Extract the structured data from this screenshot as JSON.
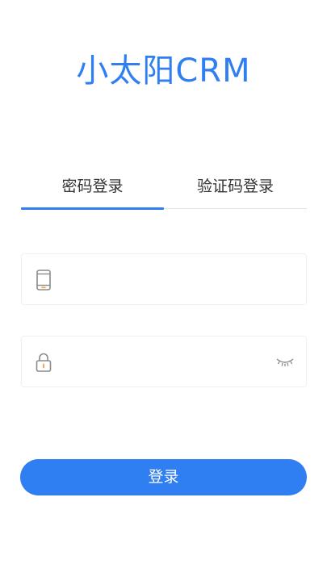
{
  "app": {
    "title": "小太阳CRM"
  },
  "tabs": [
    {
      "label": "密码登录",
      "active": true
    },
    {
      "label": "验证码登录",
      "active": false
    }
  ],
  "form": {
    "phone": {
      "value": "",
      "placeholder": "",
      "icon": "phone-icon"
    },
    "password": {
      "value": "",
      "placeholder": "",
      "icon": "lock-icon",
      "toggle_icon": "eye-closed-icon"
    }
  },
  "login_button": {
    "label": "登录"
  },
  "colors": {
    "accent": "#2f7ef2",
    "icon_gray": "#8a8a8a",
    "icon_orange": "#f2a03d"
  }
}
